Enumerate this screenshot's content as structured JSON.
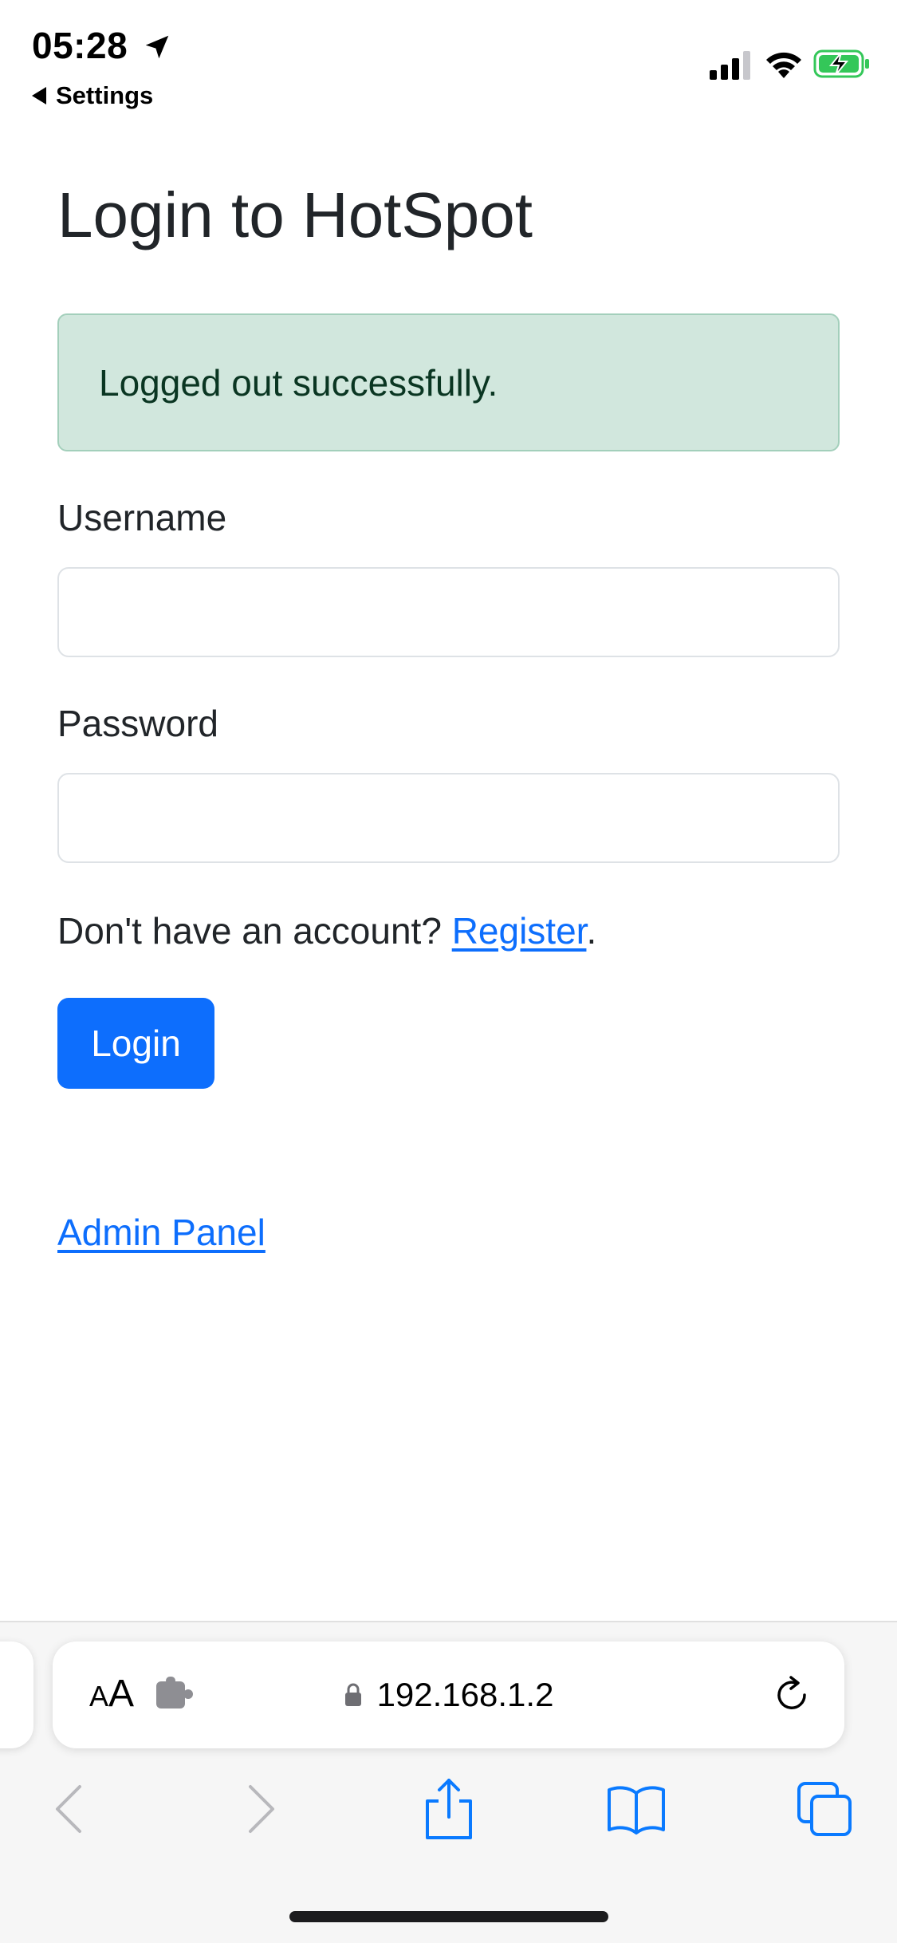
{
  "status_bar": {
    "time": "05:28",
    "back_label": "Settings"
  },
  "page": {
    "title": "Login to HotSpot",
    "alert": "Logged out successfully.",
    "username_label": "Username",
    "username_value": "",
    "password_label": "Password",
    "password_value": "",
    "register_prompt": "Don't have an account? ",
    "register_link": "Register",
    "register_suffix": ".",
    "login_button": "Login",
    "admin_link": "Admin Panel"
  },
  "browser": {
    "text_size_label_small": "A",
    "text_size_label_large": "A",
    "url": "192.168.1.2"
  },
  "colors": {
    "primary": "#0d6efd",
    "alert_bg": "#d1e7dd",
    "alert_border": "#a3cfbb",
    "alert_text": "#0a3622",
    "toolbar_blue": "#0a7aff",
    "battery_green": "#34c759"
  },
  "icons": {
    "location": "location-arrow-icon",
    "signal": "cellular-signal-icon",
    "wifi": "wifi-icon",
    "battery": "battery-charging-icon",
    "extension": "puzzle-extension-icon",
    "lock": "lock-icon",
    "reload": "reload-icon",
    "back": "chevron-left-icon",
    "forward": "chevron-right-icon",
    "share": "share-icon",
    "bookmarks": "book-icon",
    "tabs": "tabs-icon"
  }
}
